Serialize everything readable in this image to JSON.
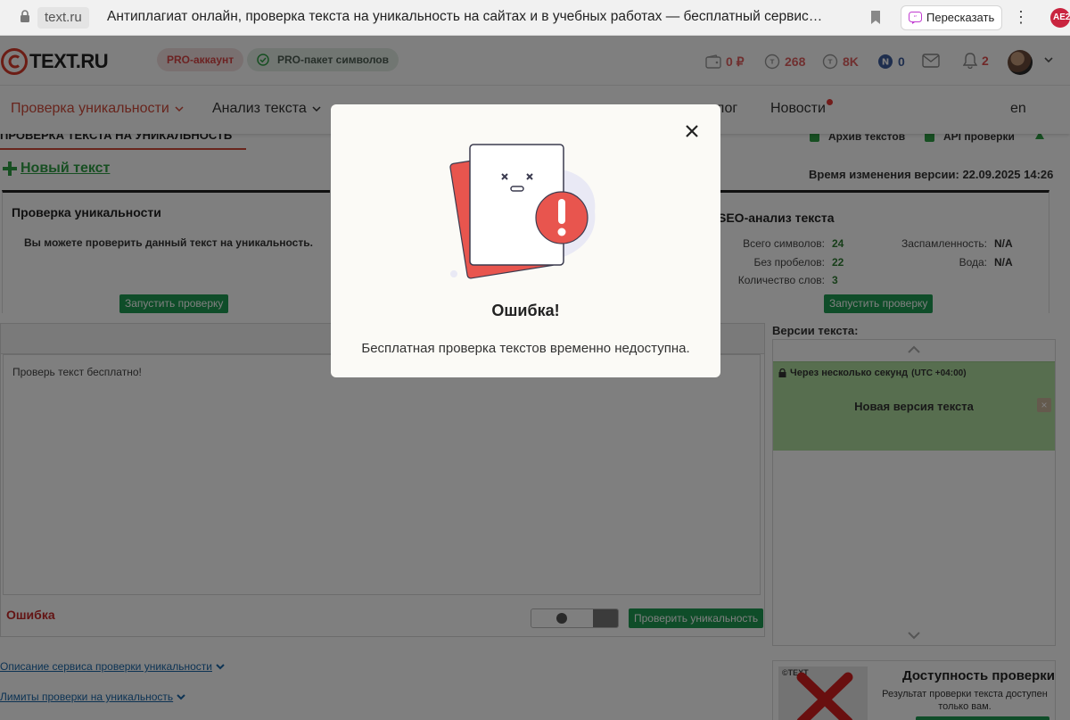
{
  "browser": {
    "url": "text.ru",
    "tab_title": "Антиплагиат онлайн, проверка текста на уникальность на сайтах и в учебных работах — бесплатный сервис…",
    "retell_label": "Пересказать",
    "more_label": "⋮",
    "ext_label": "AE2"
  },
  "header": {
    "logo_text": "TEXT.RU",
    "pro_account": "PRO-аккаунт",
    "pro_pack": "PRO-пакет символов",
    "wallet": "0 ₽",
    "rub_count": "268",
    "tokens": "8K",
    "n_count": "0",
    "notifications": "2"
  },
  "nav": {
    "check": "Проверка уникальности",
    "analysis": "Анализ текста",
    "blog": "лог",
    "news": "Новости",
    "lang": "en"
  },
  "page": {
    "title": "ПРОВЕРКА ТЕКСТА НА УНИКАЛЬНОСТЬ",
    "archive": "Архив текстов",
    "api": "API проверки",
    "new_text": "Новый текст",
    "version_time": "Время изменения версии: 22.09.2025 14:26"
  },
  "uniq_panel": {
    "title": "Проверка уникальности",
    "desc": "Вы можете проверить данный текст на уникальность.",
    "button": "Запустить проверку"
  },
  "seo_panel": {
    "title": "SEO-анализ текста",
    "total_chars_label": "Всего символов:",
    "total_chars": "24",
    "no_spaces_label": "Без пробелов:",
    "no_spaces": "22",
    "words_label": "Количество слов:",
    "words": "3",
    "spam_label": "Заспамленность:",
    "spam": "N/A",
    "water_label": "Вода:",
    "water": "N/A",
    "button": "Запустить проверку"
  },
  "editor": {
    "text": "Проверь текст бесплатно!",
    "error": "Ошибка",
    "check_button": "Проверить уникальность"
  },
  "versions": {
    "title": "Версии текста:",
    "when": "Через несколько секунд",
    "tz": "(UTC +04:00)",
    "name": "Новая версия текста",
    "delete": "×"
  },
  "footer": {
    "link1": "Описание сервиса проверки уникальности",
    "link2": "Лимиты проверки на уникальность"
  },
  "availability": {
    "title": "Доступность проверки",
    "desc": "Результат проверки текста доступен только вам.",
    "thumb_label": "©TEXT"
  },
  "modal": {
    "title": "Ошибка!",
    "message": "Бесплатная проверка текстов временно недоступна."
  },
  "colors": {
    "brand_red": "#d04a3a",
    "green": "#1f9b53",
    "error": "#c62828"
  }
}
